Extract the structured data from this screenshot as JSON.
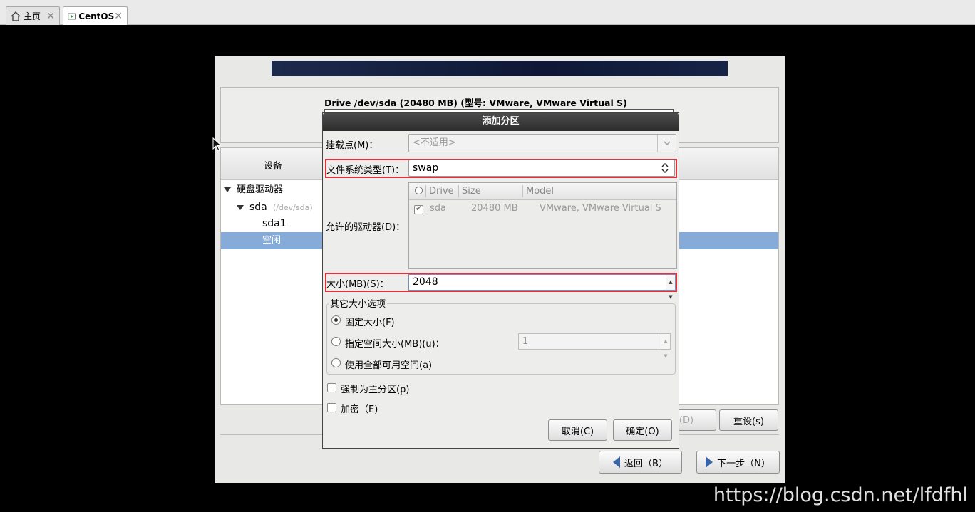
{
  "host_tabs": [
    {
      "label": "主页",
      "icon": "home-icon"
    },
    {
      "label": "CentOS",
      "icon": "vm-icon"
    }
  ],
  "installer": {
    "drive_title": "Drive /dev/sda (20480 MB) (型号: VMware, VMware Virtual S)",
    "tree_header": "设备",
    "tree": {
      "root": "硬盘驱动器",
      "disk": "sda",
      "disk_path": "(/dev/sda)",
      "part1": "sda1",
      "free": "空闲"
    },
    "buttons": {
      "delete": "(D)",
      "reset": "重设(s)",
      "back": "返回（B）",
      "next": "下一步（N）"
    }
  },
  "dialog": {
    "title": "添加分区",
    "mount_label": "挂载点(M)：",
    "mount_placeholder": "<不适用>",
    "fs_label": "文件系统类型(T)：",
    "fs_value": "swap",
    "drives_label": "允许的驱动器(D)：",
    "drive_table": {
      "headers": [
        "Drive",
        "Size",
        "Model"
      ],
      "rows": [
        {
          "drive": "sda",
          "size": "20480 MB",
          "model": "VMware, VMware Virtual S",
          "checked": true
        }
      ]
    },
    "size_label": "大小(MB)(S)：",
    "size_value": "2048",
    "size_options_legend": "其它大小选项",
    "opt_fixed": "固定大小(F)",
    "opt_upto": "指定空间大小(MB)(u)：",
    "opt_upto_value": "1",
    "opt_fill": "使用全部可用空间(a)",
    "force_primary": "强制为主分区(p)",
    "encrypt": "加密（E)",
    "cancel": "取消(C)",
    "ok": "确定(O)"
  },
  "watermark": "https://blog.csdn.net/lfdfhl",
  "colors": {
    "highlight": "#e0323a",
    "selection": "#86abd9"
  }
}
